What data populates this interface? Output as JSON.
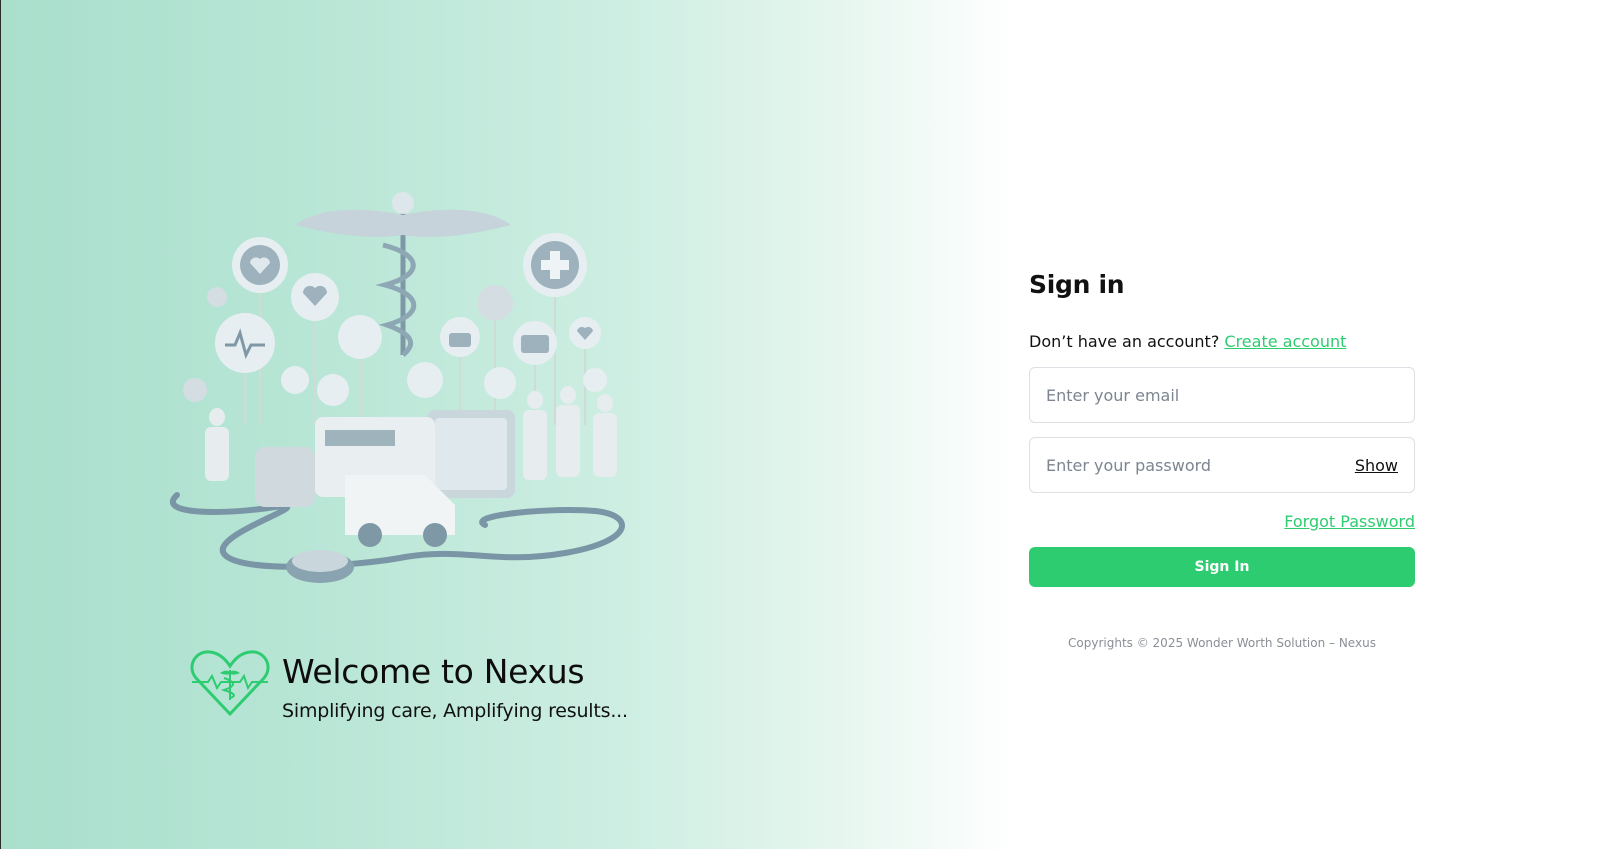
{
  "brand": {
    "title": "Welcome to Nexus",
    "subtitle": "Simplifying care, Amplifying results...",
    "logo_icon": "heart-caduceus-icon",
    "accent_color": "#2ecc71"
  },
  "hero": {
    "illustration": "medical-illustration"
  },
  "signin": {
    "title": "Sign in",
    "no_account_text": "Don’t have an account?",
    "create_account_label": "Create account",
    "email_placeholder": "Enter your email",
    "email_value": "",
    "password_placeholder": "Enter your password",
    "password_value": "",
    "show_label": "Show",
    "forgot_label": "Forgot Password",
    "submit_label": "Sign In"
  },
  "footer": {
    "copyright": "Copyrights © 2025 Wonder Worth Solution – Nexus"
  },
  "colors": {
    "primary": "#2ecc71",
    "background_left": "#a9dfcc",
    "background_right": "#ffffff"
  }
}
